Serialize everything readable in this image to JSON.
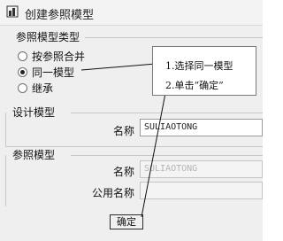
{
  "window": {
    "title": "创建参照模型"
  },
  "reference_model_type": {
    "title": "参照模型类型",
    "options": [
      {
        "label": "按参照合并",
        "checked": false
      },
      {
        "label": "同一模型",
        "checked": true
      },
      {
        "label": "继承",
        "checked": false
      }
    ]
  },
  "design_model": {
    "title": "设计模型",
    "name_label": "名称",
    "name_value": "SULIAOTONG"
  },
  "reference_model": {
    "title": "参照模型",
    "name_label": "名称",
    "name_value": "SULIAOTONG",
    "common_name_label": "公用名称",
    "common_name_value": ""
  },
  "buttons": {
    "confirm": "确定"
  },
  "annotation": {
    "step1": "1.选择同一模型",
    "step2": "2.单击“确定”"
  }
}
